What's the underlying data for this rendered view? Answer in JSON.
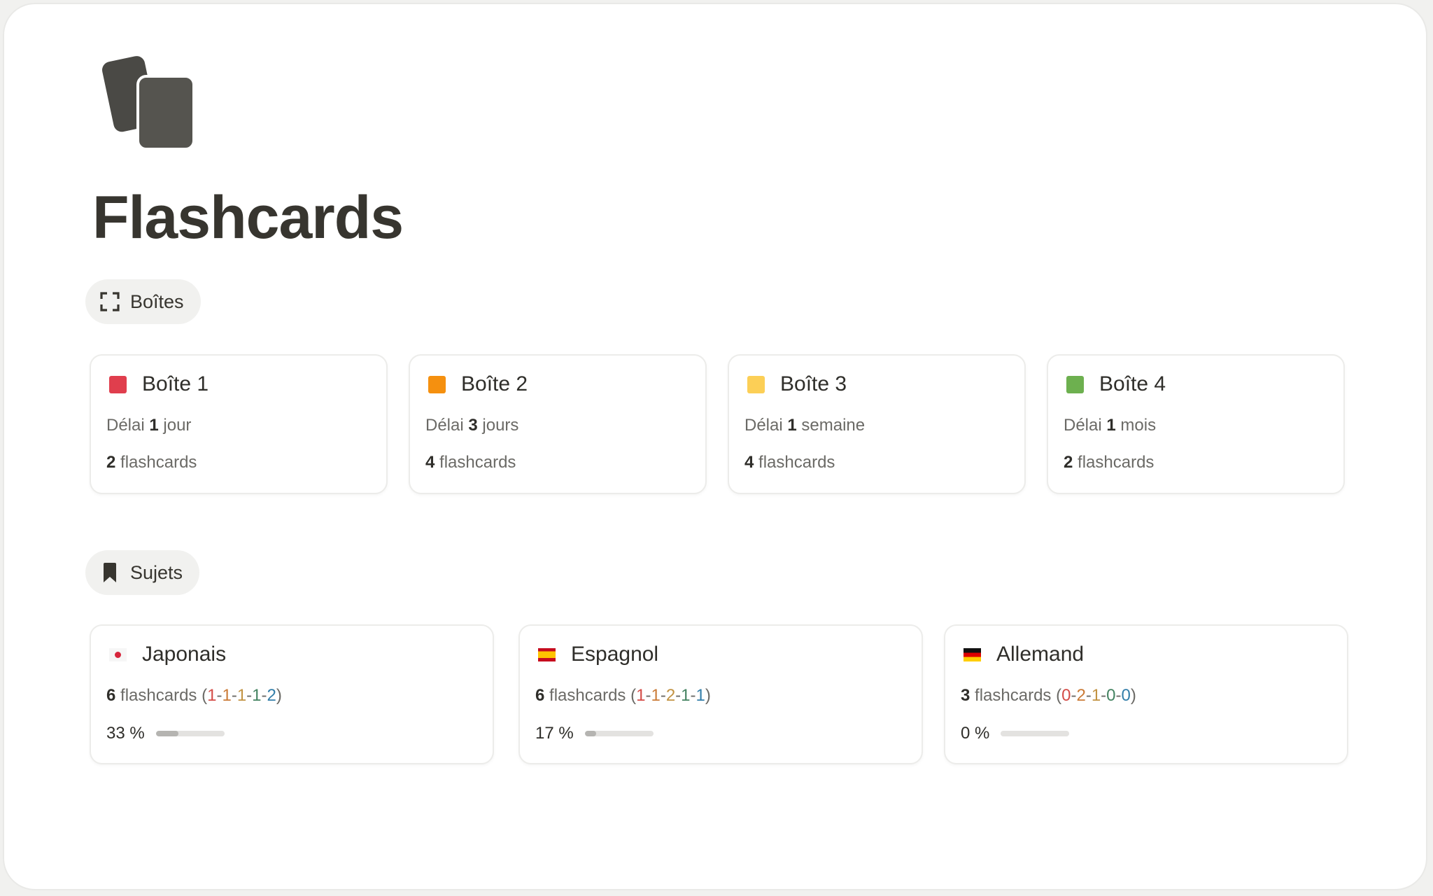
{
  "page": {
    "title": "Flashcards",
    "icon": "flashcards-stack-icon"
  },
  "boxes_section": {
    "label": "Boîtes",
    "icon": "dashed-square-icon",
    "cards": [
      {
        "title": "Boîte 1",
        "color": "#e03e4d",
        "delay_prefix": "Délai",
        "delay_value": "1",
        "delay_unit": "jour",
        "count": "2",
        "count_label": "flashcards"
      },
      {
        "title": "Boîte 2",
        "color": "#f5900f",
        "delay_prefix": "Délai",
        "delay_value": "3",
        "delay_unit": "jours",
        "count": "4",
        "count_label": "flashcards"
      },
      {
        "title": "Boîte 3",
        "color": "#fccf56",
        "delay_prefix": "Délai",
        "delay_value": "1",
        "delay_unit": "semaine",
        "count": "4",
        "count_label": "flashcards"
      },
      {
        "title": "Boîte 4",
        "color": "#6db04f",
        "delay_prefix": "Délai",
        "delay_value": "1",
        "delay_unit": "mois",
        "count": "2",
        "count_label": "flashcards"
      }
    ]
  },
  "subjects_section": {
    "label": "Sujets",
    "icon": "bookmark-icon",
    "cards": [
      {
        "title": "Japonais",
        "flag": "japan-flag-icon",
        "count": "6",
        "count_label": "flashcards",
        "open": "(",
        "close": ")",
        "d1": "1",
        "d2": "1",
        "d3": "1",
        "d4": "1",
        "d5": "2",
        "progress_text": "33 %",
        "progress_value": 0.33
      },
      {
        "title": "Espagnol",
        "flag": "spain-flag-icon",
        "count": "6",
        "count_label": "flashcards",
        "open": "(",
        "close": ")",
        "d1": "1",
        "d2": "1",
        "d3": "2",
        "d4": "1",
        "d5": "1",
        "progress_text": "17 %",
        "progress_value": 0.17
      },
      {
        "title": "Allemand",
        "flag": "germany-flag-icon",
        "count": "3",
        "count_label": "flashcards",
        "open": "(",
        "close": ")",
        "d1": "0",
        "d2": "2",
        "d3": "1",
        "d4": "0",
        "d5": "0",
        "progress_text": "0 %",
        "progress_value": 0
      }
    ]
  },
  "distribution_colors": [
    "#d44c47",
    "#cb7b37",
    "#c29343",
    "#448361",
    "#337ea9"
  ],
  "separator": "-"
}
